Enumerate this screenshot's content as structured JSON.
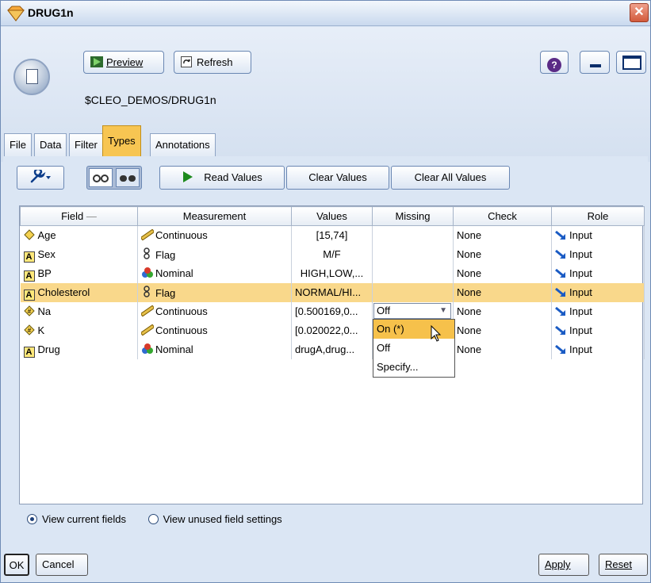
{
  "window": {
    "title": "DRUG1n",
    "close_glyph": "✕"
  },
  "toolbar": {
    "preview_label": "Preview",
    "refresh_label": "Refresh",
    "help_glyph": "?"
  },
  "source_path": "$CLEO_DEMOS/DRUG1n",
  "tabs": [
    {
      "label": "File",
      "active": false
    },
    {
      "label": "Data",
      "active": false
    },
    {
      "label": "Filter",
      "active": false
    },
    {
      "label": "Types",
      "active": true
    },
    {
      "label": "Annotations",
      "active": false
    }
  ],
  "types_toolbar": {
    "read_values_label": "Read Values",
    "clear_values_label": "Clear Values",
    "clear_all_values_label": "Clear All Values"
  },
  "table": {
    "columns": [
      "Field",
      "Measurement",
      "Values",
      "Missing",
      "Check",
      "Role"
    ],
    "rows": [
      {
        "field": "Age",
        "field_icon": "continuous-diamond-icon",
        "measurement": "Continuous",
        "meas_icon": "ruler-icon",
        "values": "[15,74]",
        "missing": "",
        "check": "None",
        "role": "Input",
        "selected": false
      },
      {
        "field": "Sex",
        "field_icon": "string-a-icon",
        "measurement": "Flag",
        "meas_icon": "flag-icon",
        "values": "M/F",
        "missing": "",
        "check": "None",
        "role": "Input",
        "selected": false
      },
      {
        "field": "BP",
        "field_icon": "string-a-icon",
        "measurement": "Nominal",
        "meas_icon": "nominal-icon",
        "values": "HIGH,LOW,...",
        "missing": "",
        "check": "None",
        "role": "Input",
        "selected": false
      },
      {
        "field": "Cholesterol",
        "field_icon": "string-a-icon",
        "measurement": "Flag",
        "meas_icon": "flag-icon",
        "values": "NORMAL/HI...",
        "missing": "Off",
        "check": "None",
        "role": "Input",
        "selected": true
      },
      {
        "field": "Na",
        "field_icon": "number-diamond-icon",
        "measurement": "Continuous",
        "meas_icon": "ruler-icon",
        "values": "[0.500169,0...",
        "missing": "",
        "check": "None",
        "role": "Input",
        "selected": false
      },
      {
        "field": "K",
        "field_icon": "number-diamond-icon",
        "measurement": "Continuous",
        "meas_icon": "ruler-icon",
        "values": "[0.020022,0...",
        "missing": "",
        "check": "None",
        "role": "Input",
        "selected": false
      },
      {
        "field": "Drug",
        "field_icon": "string-a-icon",
        "measurement": "Nominal",
        "meas_icon": "nominal-icon",
        "values": "drugA,drug...",
        "missing": "",
        "check": "None",
        "role": "Input",
        "selected": false
      }
    ]
  },
  "missing_dropdown": {
    "current": "Off",
    "options": [
      "On (*)",
      "Off",
      "Specify..."
    ],
    "highlighted": "On (*)"
  },
  "view_options": {
    "current_label": "View current fields",
    "unused_label": "View unused field settings",
    "selected": "current"
  },
  "footer": {
    "ok_label": "OK",
    "cancel_label": "Cancel",
    "apply_label": "Apply",
    "reset_label": "Reset"
  }
}
